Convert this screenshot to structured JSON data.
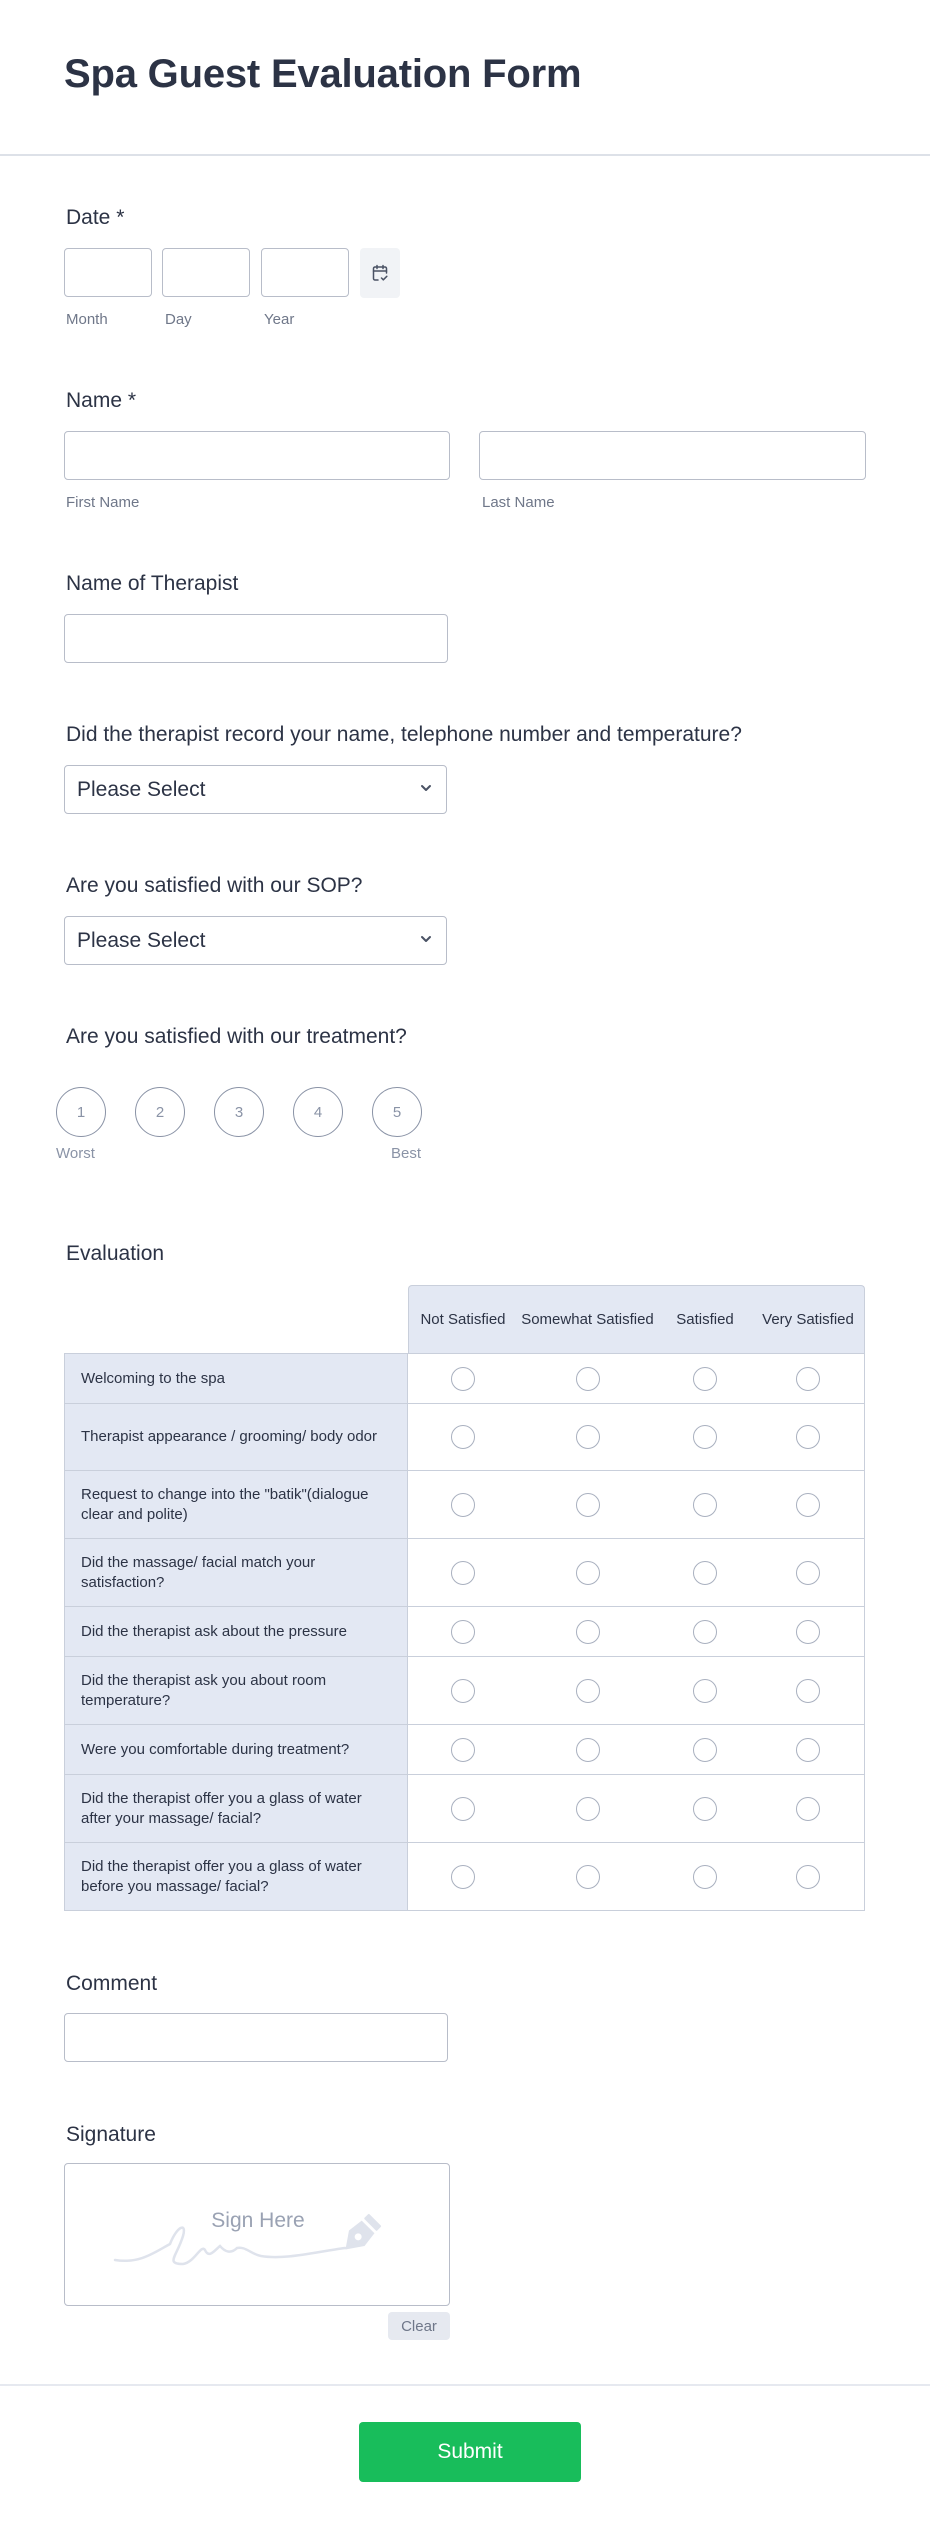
{
  "form": {
    "title": "Spa Guest Evaluation Form"
  },
  "date": {
    "label": "Date *",
    "month_label": "Month",
    "day_label": "Day",
    "year_label": "Year",
    "month_value": "",
    "day_value": "",
    "year_value": "",
    "calendar_icon": "calendar-icon"
  },
  "name": {
    "label": "Name *",
    "first_label": "First Name",
    "last_label": "Last Name",
    "first_value": "",
    "last_value": ""
  },
  "therapist": {
    "label": "Name of Therapist",
    "value": ""
  },
  "record_question": {
    "label": "Did the therapist record your name, telephone number and temperature?",
    "selected": "Please Select"
  },
  "sop_question": {
    "label": "Are you satisfied with our SOP?",
    "selected": "Please Select"
  },
  "treatment_rating": {
    "label": "Are you satisfied with our treatment?",
    "options": [
      "1",
      "2",
      "3",
      "4",
      "5"
    ],
    "min_caption": "Worst",
    "max_caption": "Best"
  },
  "evaluation": {
    "label": "Evaluation",
    "columns": [
      "Not Satisfied",
      "Somewhat Satisfied",
      "Satisfied",
      "Very Satisfied"
    ],
    "rows": [
      "Welcoming to the spa",
      "Therapist appearance / grooming/ body odor",
      "Request to change into the \"batik\"(dialogue clear and polite)",
      "Did the massage/ facial match your satisfaction?",
      "Did the therapist ask about the pressure",
      "Did the therapist ask you about room temperature?",
      "Were you comfortable during treatment?",
      "Did the therapist offer you a glass of water after your massage/ facial?",
      "Did the therapist offer you a glass of water before you massage/ facial?"
    ]
  },
  "comment": {
    "label": "Comment",
    "value": ""
  },
  "signature": {
    "label": "Signature",
    "placeholder": "Sign Here",
    "clear_label": "Clear"
  },
  "submit": {
    "label": "Submit",
    "color": "#18bd5b"
  }
}
